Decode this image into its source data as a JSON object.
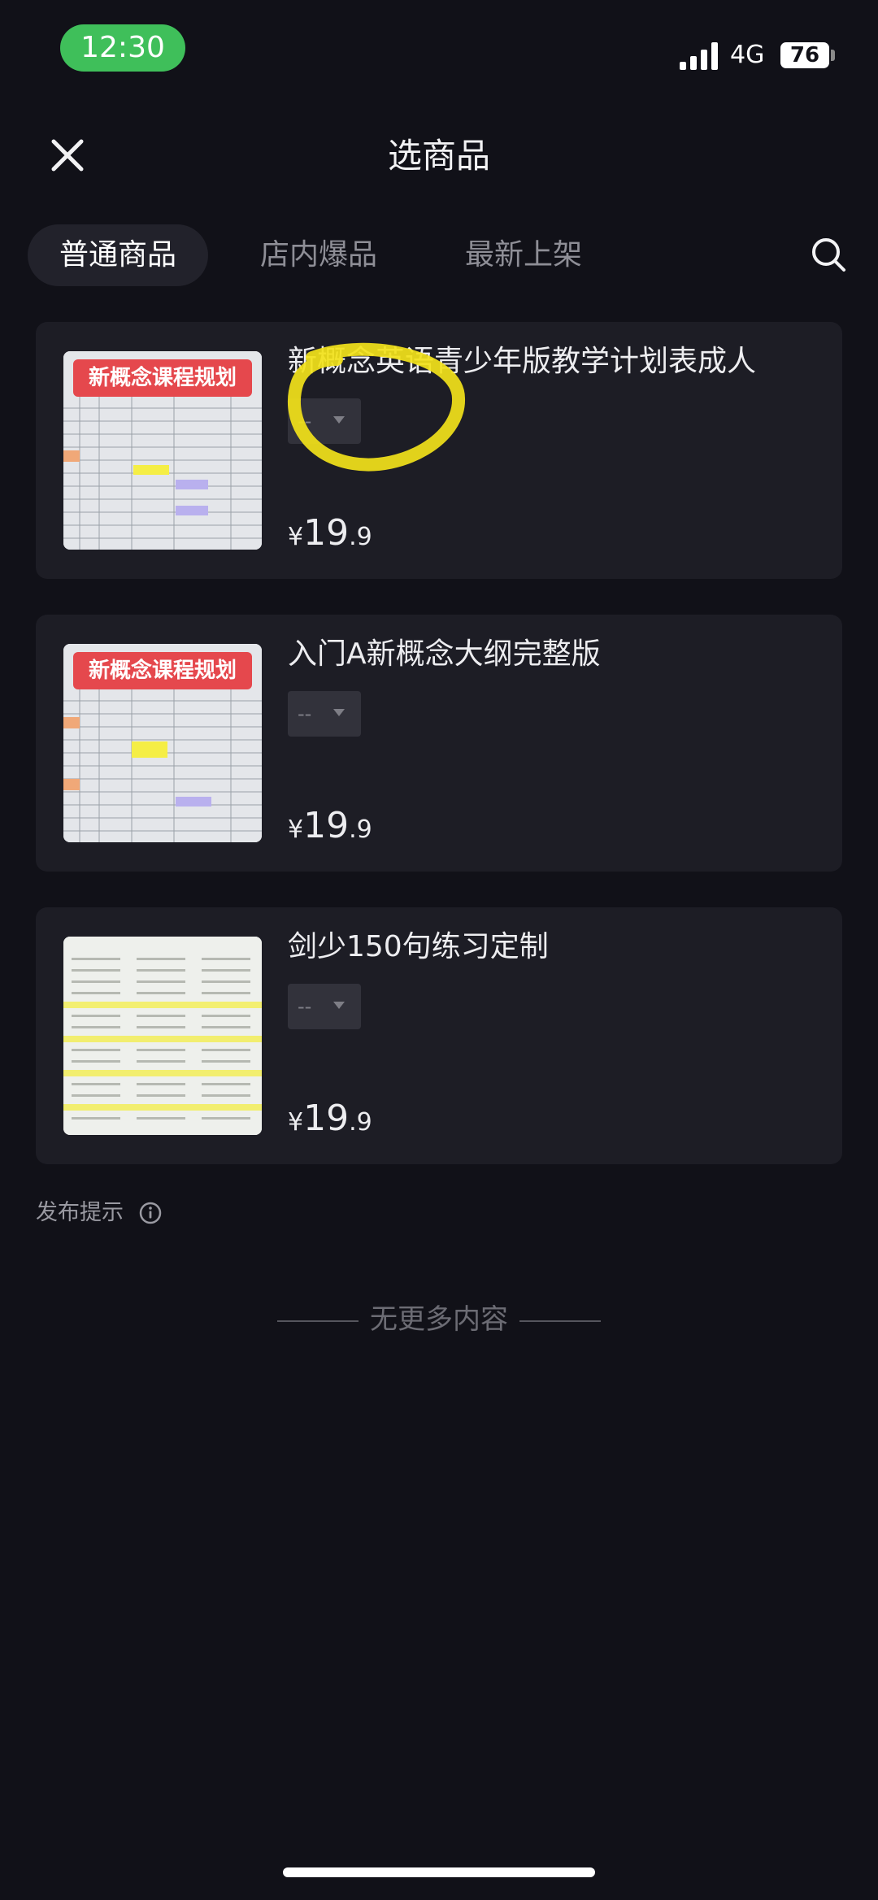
{
  "status_bar": {
    "time": "12:30",
    "network": "4G",
    "battery": "76",
    "time_pill_color": "#3fbf5a"
  },
  "header": {
    "title": "选商品"
  },
  "tabs": [
    {
      "label": "普通商品",
      "active": true
    },
    {
      "label": "店内爆品",
      "active": false
    },
    {
      "label": "最新上架",
      "active": false
    }
  ],
  "products": [
    {
      "title": "新概念英语青少年版教学计划表成人",
      "spec": "--",
      "price_symbol": "¥",
      "price_int": "19",
      "price_dec": ".9",
      "thumb_banner": "新概念课程规划",
      "highlighted": true
    },
    {
      "title": "入门A新概念大纲完整版",
      "spec": "--",
      "price_symbol": "¥",
      "price_int": "19",
      "price_dec": ".9",
      "thumb_banner": "新概念课程规划"
    },
    {
      "title": "剑少150句练习定制",
      "spec": "--",
      "price_symbol": "¥",
      "price_int": "19",
      "price_dec": ".9"
    }
  ],
  "footer": {
    "publish_tip": "发布提示",
    "no_more": "无更多内容"
  },
  "colors": {
    "background": "#111118",
    "card": "#1d1d25",
    "highlight": "#f2e21a",
    "banner": "#e5484d"
  },
  "icons": [
    "close-icon",
    "search-icon",
    "signal-icon",
    "info-icon",
    "chevron-down-icon"
  ]
}
